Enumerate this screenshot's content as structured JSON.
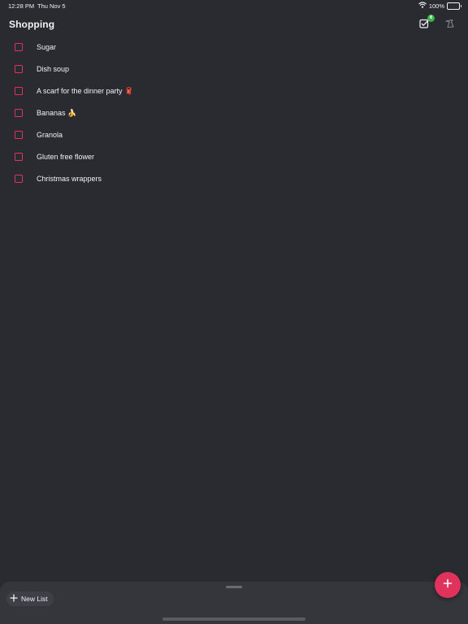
{
  "status_bar": {
    "time": "12:28 PM",
    "date": "Thu Nov 5",
    "battery": "100%",
    "wifi_icon": "wifi-icon",
    "battery_icon": "battery-icon"
  },
  "header": {
    "title": "Shopping",
    "checked_count": "6",
    "checks_icon": "checkbox-checked-icon",
    "clear_icon": "clear-completed-icon"
  },
  "items": [
    {
      "label": "Sugar"
    },
    {
      "label": "Dish soup"
    },
    {
      "label": "A scarf for the dinner party 🧣"
    },
    {
      "label": "Bananas 🍌"
    },
    {
      "label": "Granola"
    },
    {
      "label": "Gluten free flower"
    },
    {
      "label": "Christmas wrappers"
    }
  ],
  "bottom": {
    "new_list_label": "New List",
    "add_icon": "plus-icon"
  },
  "colors": {
    "background": "#2a2b31",
    "accent": "#e0325c",
    "badge": "#3bb54a",
    "panel": "#35363c"
  }
}
